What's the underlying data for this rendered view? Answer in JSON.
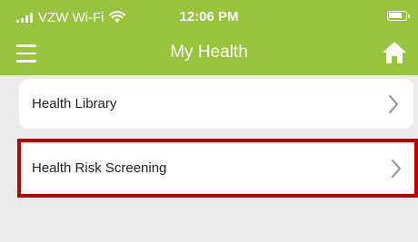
{
  "status_bar": {
    "carrier": "VZW Wi-Fi",
    "time": "12:06 PM",
    "signal_icon": "cellular-signal-icon",
    "wifi_icon": "wifi-icon",
    "battery_icon": "battery-icon"
  },
  "nav": {
    "title": "My Health",
    "menu_icon": "hamburger-menu-icon",
    "home_icon": "home-icon"
  },
  "list": {
    "items": [
      {
        "label": "Health Library",
        "icon": "chevron-right-icon",
        "highlighted": false
      },
      {
        "label": "Health Risk Screening",
        "icon": "chevron-right-icon",
        "highlighted": true
      }
    ]
  },
  "colors": {
    "header": "#97c33d",
    "background": "#ebebeb",
    "card": "#ffffff",
    "highlight_border": "#c00000",
    "chevron": "#8e8e93"
  }
}
